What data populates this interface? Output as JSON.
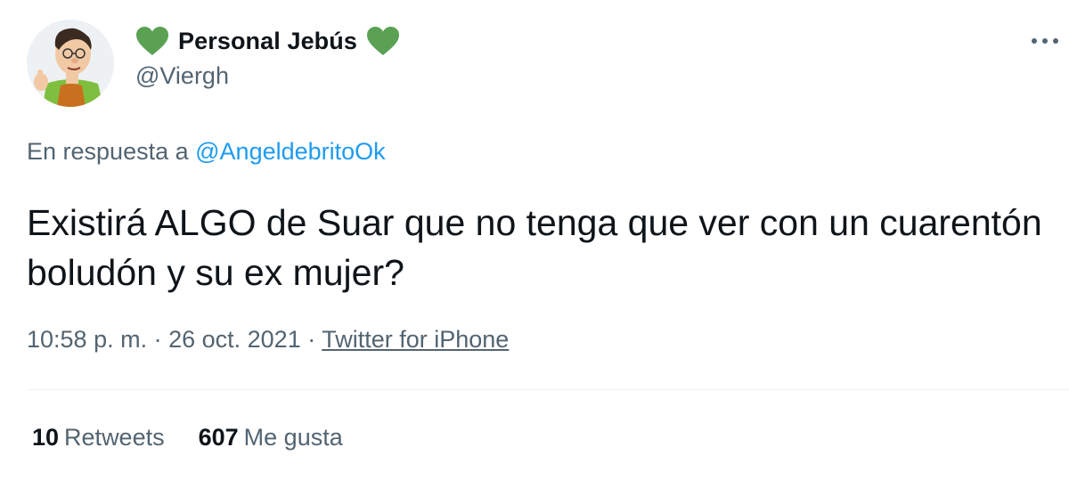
{
  "author": {
    "display_name": "Personal Jebús",
    "handle": "@Viergh",
    "name_emoji_icon": "green-heart-icon",
    "avatar_icon": "cartoon-avatar"
  },
  "reply": {
    "prefix": "En respuesta a",
    "mention": "@AngeldebritoOk"
  },
  "tweet": {
    "text": "Existirá ALGO de Suar que no tenga que ver con un cuarentón boludón y su ex mujer?"
  },
  "meta": {
    "time": "10:58 p. m.",
    "sep1": " · ",
    "date": "26 oct. 2021",
    "sep2": " · ",
    "source": "Twitter for iPhone"
  },
  "stats": {
    "retweets_count": "10",
    "retweets_label": "Retweets",
    "likes_count": "607",
    "likes_label": "Me gusta"
  },
  "colors": {
    "link": "#1d9bf0",
    "secondary_text": "#536471",
    "primary_text": "#0f1419",
    "heart": "#5aa154"
  }
}
